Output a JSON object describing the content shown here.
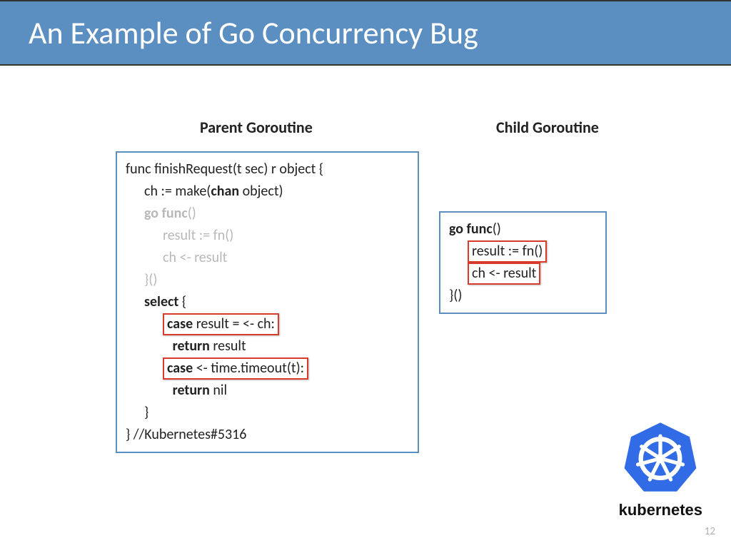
{
  "title": "An Example of Go Concurrency Bug",
  "headings": {
    "parent": "Parent Goroutine",
    "child": "Child Goroutine"
  },
  "parent": {
    "l1a": "func finishRequest(t sec) r object {",
    "l2a": "ch := make(",
    "l2b": "chan",
    "l2c": " object)",
    "l3a": "go func",
    "l3b": "()",
    "l4": "result := fn()",
    "l5": "ch <- result",
    "l6": "}()",
    "l7a": "select",
    "l7b": " {",
    "l8a": "case",
    "l8b": " result = <- ch:",
    "l9a": "return",
    "l9b": " result",
    "l10a": "case",
    "l10b": " <- time.timeout(t):",
    "l11a": "return",
    "l11b": " nil",
    "l12": "}",
    "l13": "} //Kubernetes#5316"
  },
  "child": {
    "l1a": "go func",
    "l1b": "()",
    "l2": "result := fn()",
    "l3": "ch <- result",
    "l4": "}()"
  },
  "logo": {
    "label": "kubernetes"
  },
  "pagenum": "12"
}
